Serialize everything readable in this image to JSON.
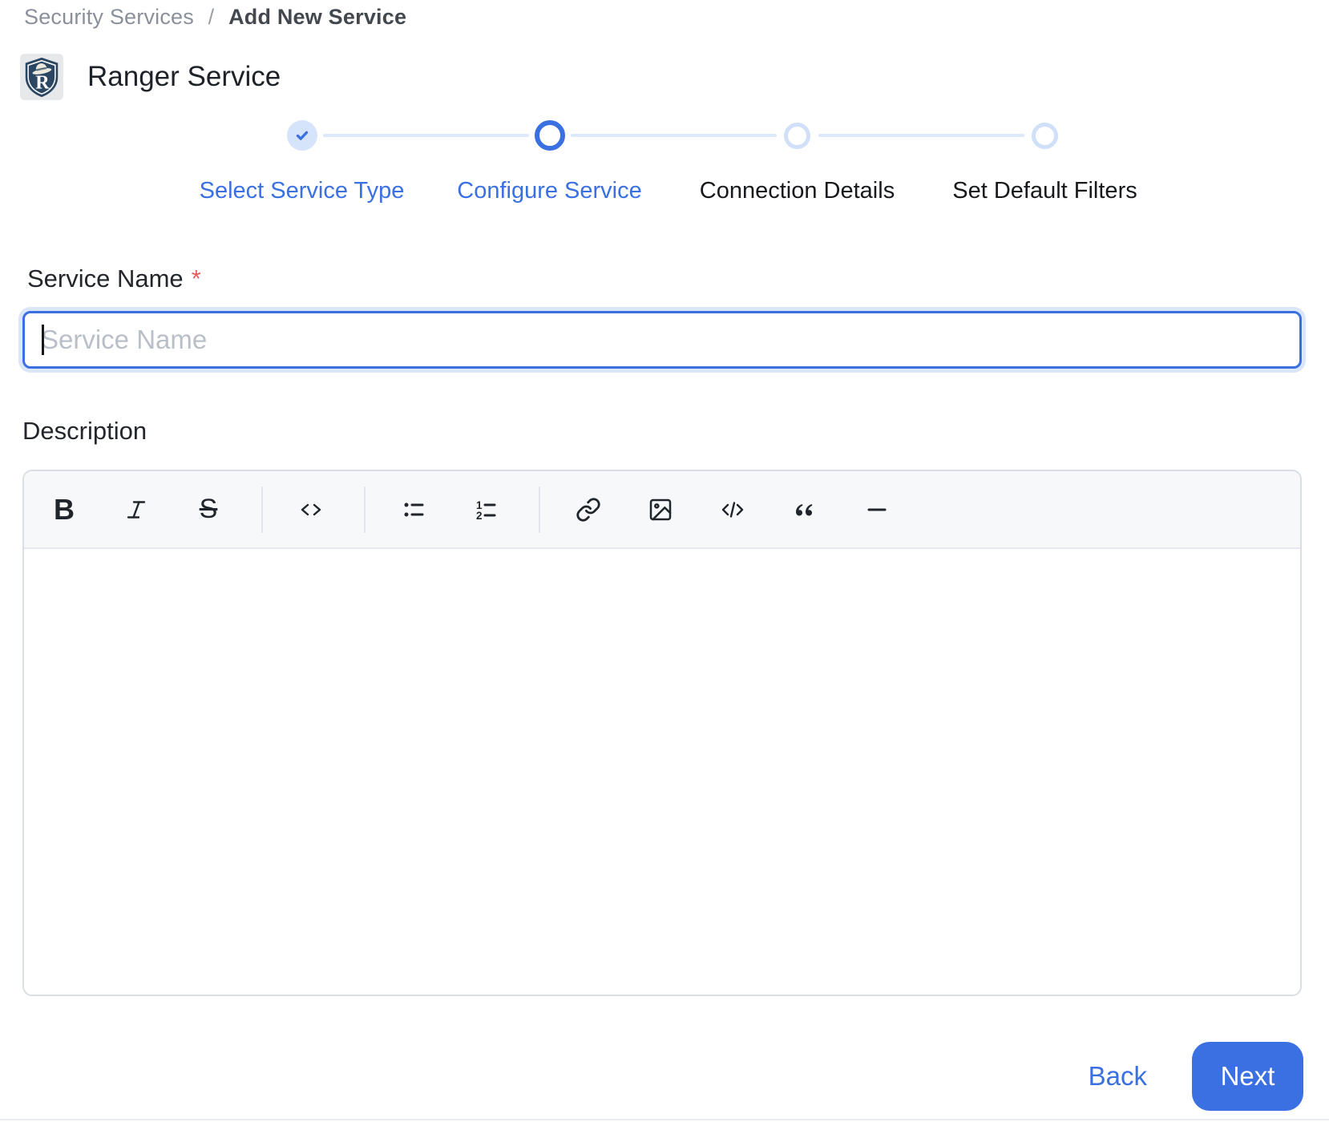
{
  "breadcrumb": {
    "parent": "Security Services",
    "separator": "/",
    "current": "Add New Service"
  },
  "header": {
    "title": "Ranger Service",
    "logo": "ranger-shield-logo",
    "logo_letter": "R"
  },
  "stepper": {
    "steps": [
      {
        "label": "Select Service Type",
        "state": "completed"
      },
      {
        "label": "Configure Service",
        "state": "active"
      },
      {
        "label": "Connection Details",
        "state": "upcoming"
      },
      {
        "label": "Set Default Filters",
        "state": "upcoming"
      }
    ]
  },
  "form": {
    "service_name": {
      "label": "Service Name",
      "required_marker": "*",
      "placeholder": "Service Name",
      "value": ""
    },
    "description": {
      "label": "Description",
      "value": ""
    }
  },
  "toolbar": {
    "bold_glyph": "B",
    "strikethrough_glyph": "S",
    "buttons": [
      "bold",
      "italic",
      "strikethrough",
      "inline-code",
      "bullet-list",
      "ordered-list",
      "link",
      "image",
      "code-block",
      "blockquote",
      "horizontal-rule"
    ]
  },
  "footer": {
    "back_label": "Back",
    "next_label": "Next"
  },
  "colors": {
    "primary_blue": "#3a70e2",
    "completed_step_fill": "#d5e3fb",
    "inactive_step_border": "#cfe0f8",
    "connector_line": "#dce8fb",
    "required_red": "#e45d5d",
    "toolbar_bg": "#f7f8fa",
    "border_gray": "#d9dee6",
    "placeholder_gray": "#b9bfc8",
    "breadcrumb_gray": "#8a909a"
  }
}
